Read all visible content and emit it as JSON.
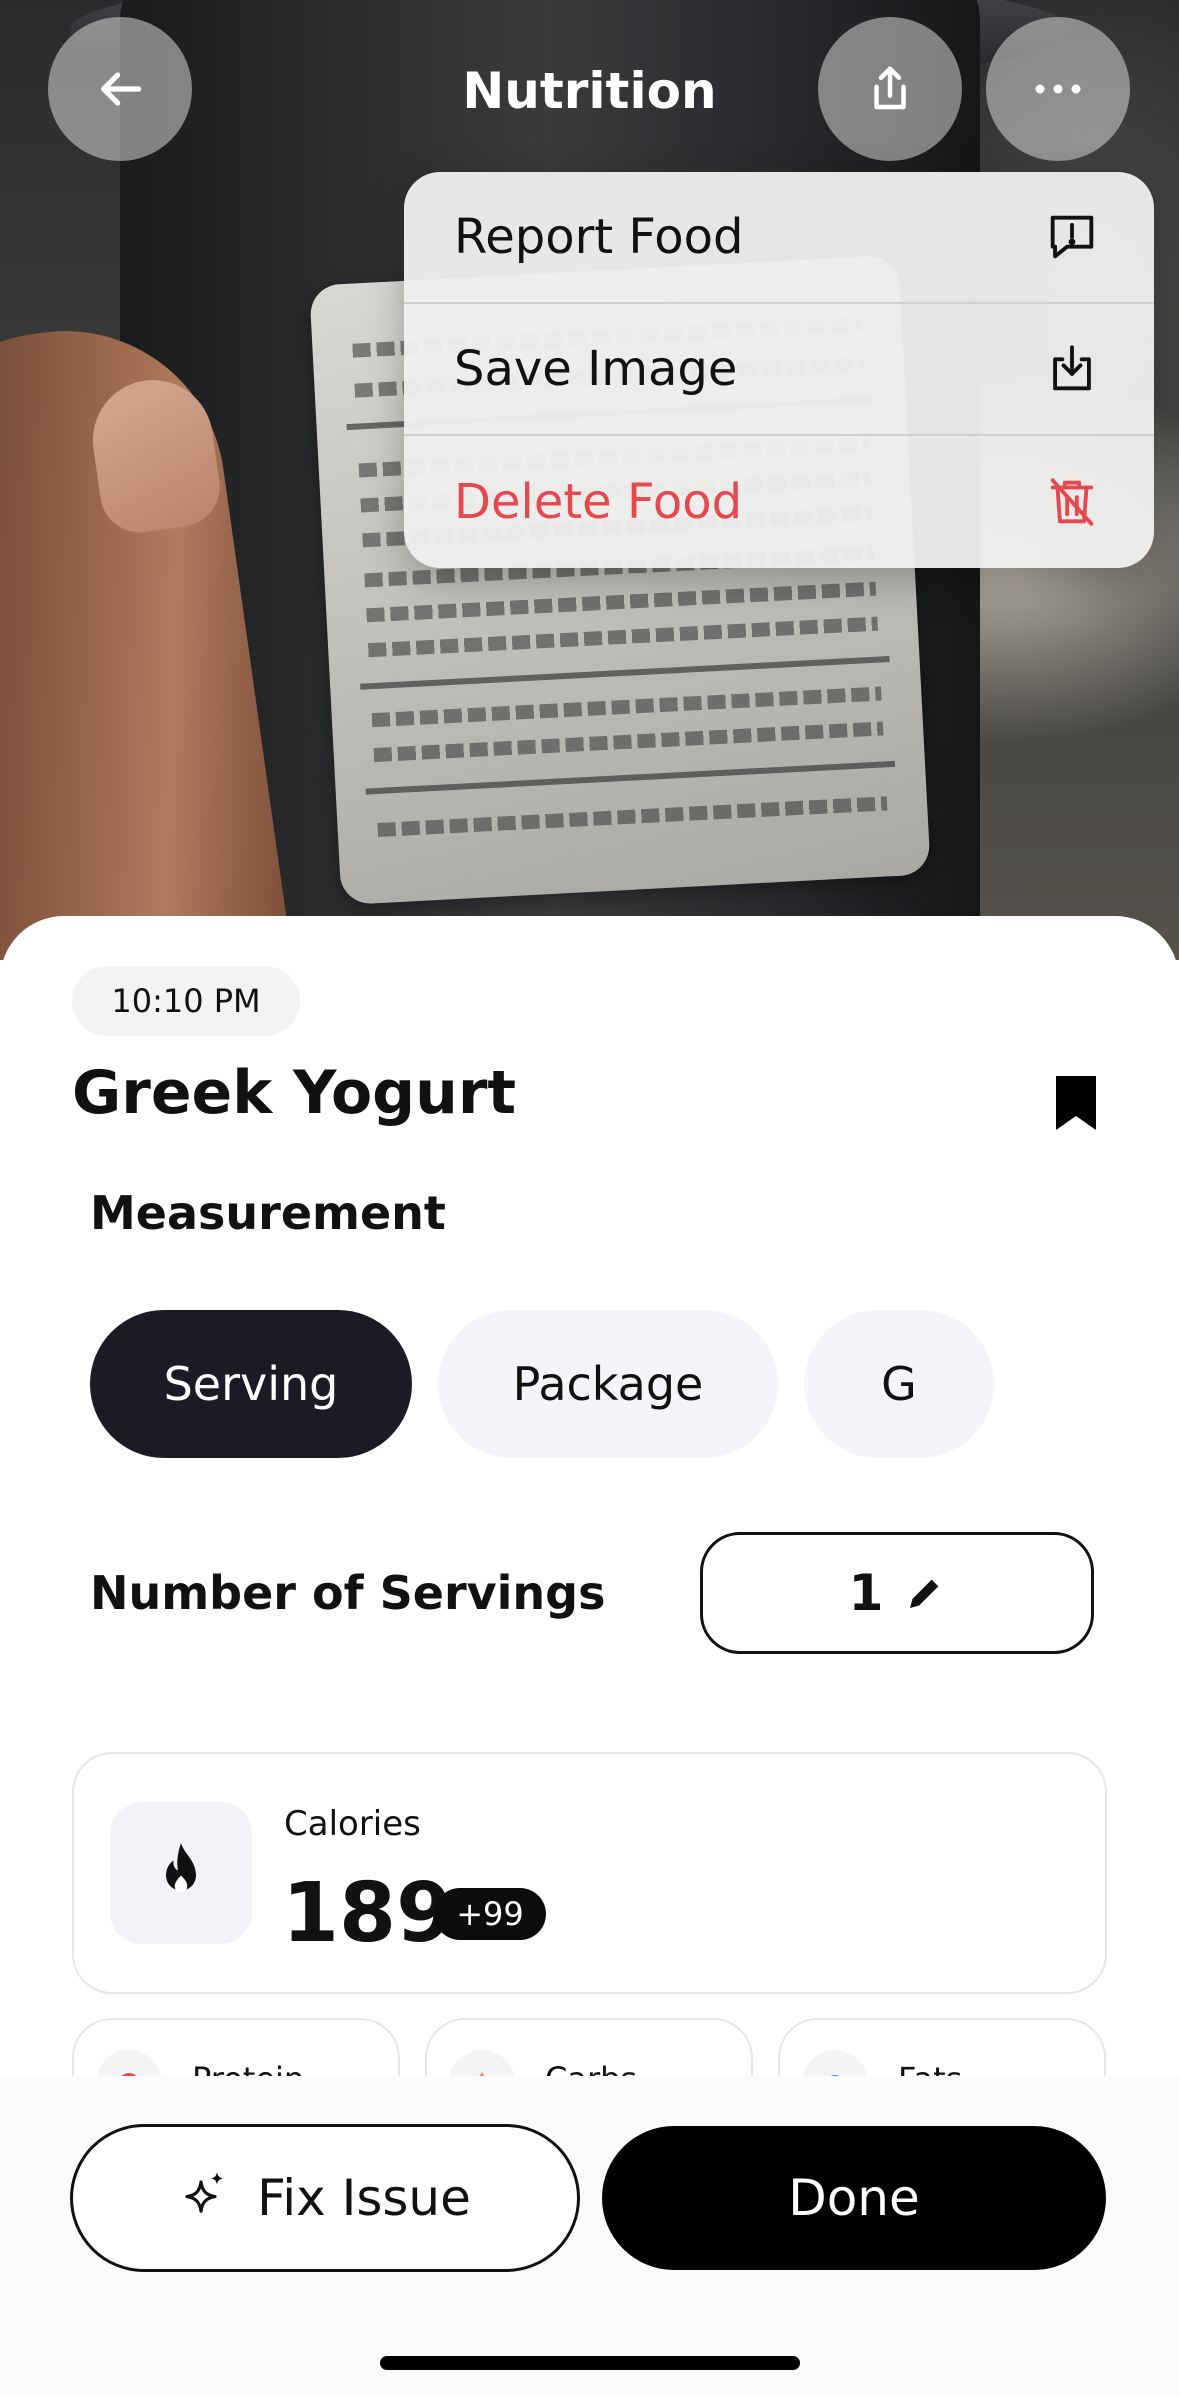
{
  "header": {
    "title": "Nutrition",
    "back_icon": "arrow-left-icon",
    "share_icon": "share-icon",
    "more_icon": "ellipsis-icon"
  },
  "menu": {
    "items": [
      {
        "label": "Report Food",
        "icon": "report-icon"
      },
      {
        "label": "Save Image",
        "icon": "download-icon"
      },
      {
        "label": "Delete Food",
        "icon": "trash-icon",
        "color": "#e5484d"
      }
    ]
  },
  "entry": {
    "time": "10:10 PM",
    "title": "Greek Yogurt",
    "bookmark_icon": "bookmark-icon"
  },
  "measurement": {
    "label": "Measurement",
    "options": [
      "Serving",
      "Package",
      "G"
    ],
    "selected": "Serving"
  },
  "servings": {
    "label": "Number of Servings",
    "value": "1",
    "edit_icon": "pencil-icon"
  },
  "calories": {
    "label": "Calories",
    "value": "189",
    "badge": "+99",
    "icon": "flame-icon"
  },
  "macros": [
    {
      "label": "Protein",
      "color": "#e5484d"
    },
    {
      "label": "Carbs",
      "color": "#e9954f"
    },
    {
      "label": "Fats",
      "color": "#4f7be9"
    }
  ],
  "actions": {
    "fix_label": "Fix Issue",
    "fix_icon": "sparkle-icon",
    "done_label": "Done"
  },
  "colors": {
    "accent_dark": "#1c1a24",
    "danger": "#e5484d"
  }
}
